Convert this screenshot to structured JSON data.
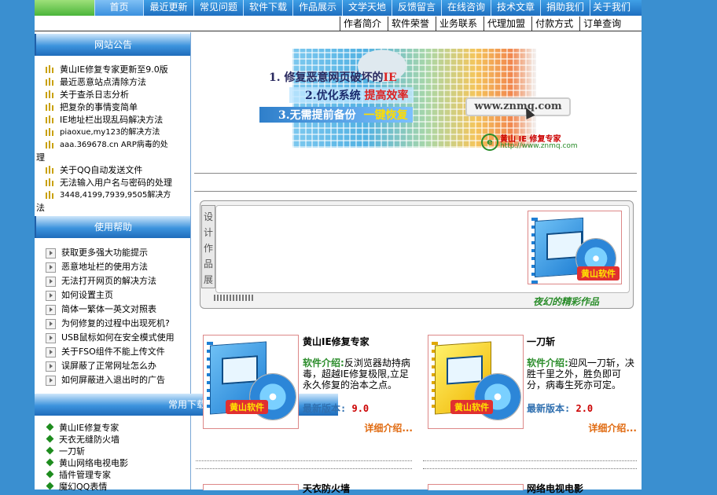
{
  "top_nav": {
    "items": [
      "首页",
      "最近更新",
      "常见问题",
      "软件下载",
      "作品展示",
      "文学天地",
      "反馈留言",
      "在线咨询",
      "技术文章",
      "捐助我们",
      "关于我们"
    ]
  },
  "sub_nav": {
    "items": [
      "作者简介",
      "软件荣誉",
      "业务联系",
      "代理加盟",
      "付款方式",
      "订单查询"
    ]
  },
  "announcements": {
    "title": "网站公告",
    "items": [
      "黄山IE修复专家更新至9.0版",
      "最近恶意站点清除方法",
      "关于查杀日志分析",
      "把复杂的事情变简单",
      "IE地址栏出现乱码解决方法",
      "piaoxue,my123的解决方法",
      "aaa.369678.cn ARP病毒的处",
      "理",
      "关于QQ自动发送文件",
      "无法输入用户名与密码的处理",
      "3448,4199,7939,9505解决方",
      "法"
    ]
  },
  "help": {
    "title": "使用帮助",
    "items": [
      "获取更多强大功能提示",
      "恶意地址栏的使用方法",
      "无法打开网页的解决方法",
      "如何设置主页",
      "简体一繁体一英文对照表",
      "为何修复的过程中出现死机?",
      "USB鼠标如何在安全模式使用",
      "关于FSO组件不能上传文件",
      "误屏蔽了正常网址怎么办",
      "如何屏蔽进入退出时的广告"
    ]
  },
  "downloads": {
    "title": "常用下载",
    "items": [
      "黄山IE修复专家",
      "天衣无缝防火墙",
      "一刀斩",
      "黄山网络电视电影",
      "插件管理专家",
      "魔幻QQ表情"
    ]
  },
  "banner": {
    "line1": "1. 修复恶意网页破坏的",
    "line1_hl": "IE",
    "line2": "2.优化系统",
    "line2_hl": "提高效率",
    "line3": "3.无需提前备份",
    "line3_hl": "一键恢复",
    "url": "www.znmq.com",
    "logo_name": "黄山 IE 修复专家",
    "logo_url": "http://www.znmq.com"
  },
  "showcase": {
    "tab_chars": [
      "设",
      "计",
      "作",
      "品",
      "展"
    ],
    "footer": "夜幻的精彩作品",
    "box_brand": "黄山软件"
  },
  "products": [
    {
      "name": "黄山IE修复专家",
      "desc_label": "软件介绍:",
      "desc": "反浏览器劫持病毒，超越IE修复极限,立足永久修复的治本之点。",
      "ver_label": "最新版本:",
      "version": "9.0",
      "more": "详细介绍...",
      "brand": "黄山软件"
    },
    {
      "name": "一刀斩",
      "desc_label": "软件介绍:",
      "desc": "迎风一刀斩，决胜千里之外，胜负即可分，病毒生死亦可定。",
      "ver_label": "最新版本:",
      "version": "2.0",
      "more": "详细介绍...",
      "brand": "黄山软件"
    }
  ],
  "products_row2": [
    {
      "name": "天衣防火墙"
    },
    {
      "name": "网络电视电影"
    }
  ],
  "colors": {
    "page_bg": "#3a8fd0",
    "nav_bg": "#1e6fc0",
    "accent_green": "#2a8c2a",
    "version_red": "#c00000",
    "more_orange": "#e06a10"
  }
}
